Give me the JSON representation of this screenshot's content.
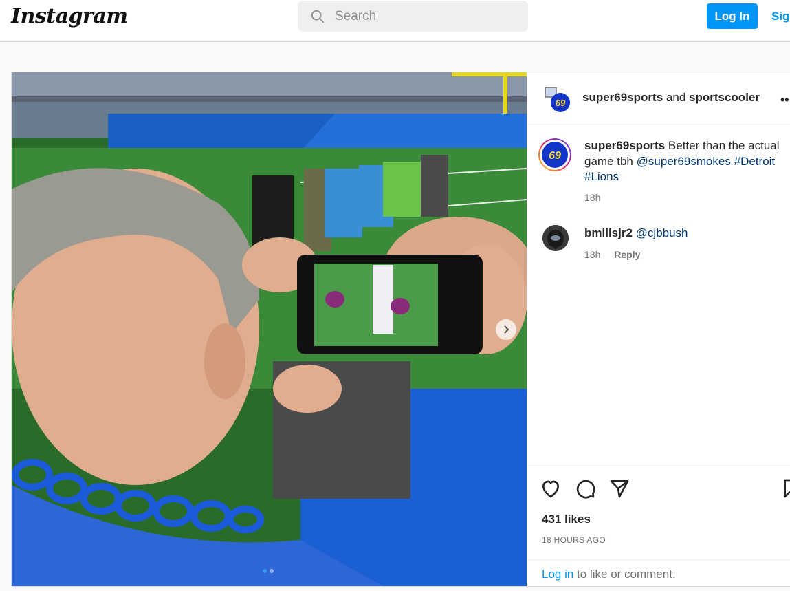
{
  "header": {
    "logo": "Instagram",
    "search_placeholder": "Search",
    "login_label": "Log In",
    "signup_label": "Sign Up"
  },
  "post": {
    "header": {
      "user1": "super69sports",
      "joiner": "and",
      "user2": "sportscooler"
    },
    "caption": {
      "username": "super69sports",
      "text": "Better than the actual game tbh",
      "mention": "@super69smokes",
      "tag1": "#Detroit",
      "tag2": "#Lions",
      "time": "18h"
    },
    "comments": [
      {
        "username": "bmillsjr2",
        "text": "@cjbbush",
        "time": "18h",
        "reply_label": "Reply"
      }
    ],
    "likes": "431 likes",
    "posted_ago": "18 HOURS AGO",
    "login_prompt": {
      "link": "Log in",
      "rest": "to like or comment."
    },
    "carousel": {
      "current": 1,
      "total": 2
    }
  },
  "colors": {
    "accent": "#0095f6",
    "link": "#00376b",
    "muted": "#737373"
  }
}
